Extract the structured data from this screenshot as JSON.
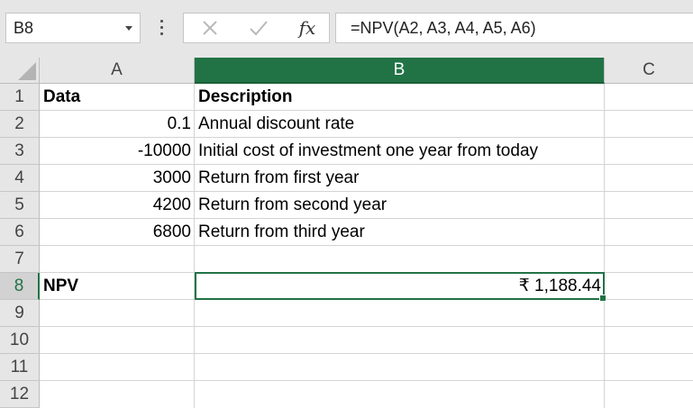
{
  "formula_bar": {
    "name_box": "B8",
    "cancel_icon": "close-icon",
    "enter_icon": "check-icon",
    "fx_label": "fx",
    "formula": "=NPV(A2, A3, A4, A5, A6)"
  },
  "columns": [
    "A",
    "B",
    "C"
  ],
  "rows": [
    "1",
    "2",
    "3",
    "4",
    "5",
    "6",
    "7",
    "8",
    "9",
    "10",
    "11",
    "12"
  ],
  "cells": {
    "A1": "Data",
    "B1": "Description",
    "A2": "0.1",
    "B2": "Annual discount rate",
    "A3": "-10000",
    "B3": "Initial cost of investment one year from today",
    "A4": "3000",
    "B4": "Return from first year",
    "A5": "4200",
    "B5": "Return from second year",
    "A6": "6800",
    "B6": "Return from third year",
    "A8": "NPV",
    "B8": "₹ 1,188.44"
  },
  "selected_cell": "B8",
  "colors": {
    "accent": "#217346"
  }
}
